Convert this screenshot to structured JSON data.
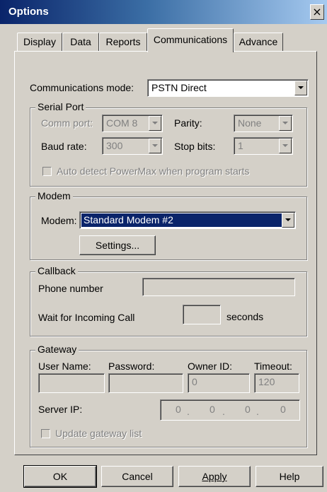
{
  "window": {
    "title": "Options",
    "close_glyph": "×"
  },
  "tabs": [
    {
      "label": "Display",
      "active": false
    },
    {
      "label": "Data",
      "active": false
    },
    {
      "label": "Reports",
      "active": false
    },
    {
      "label": "Communications",
      "active": true
    },
    {
      "label": "Advance",
      "active": false
    }
  ],
  "communications_mode": {
    "label": "Communications mode:",
    "value": "PSTN Direct"
  },
  "serial_port": {
    "legend": "Serial Port",
    "comm_port_label": "Comm port:",
    "comm_port_value": "COM 8",
    "parity_label": "Parity:",
    "parity_value": "None",
    "baud_rate_label": "Baud rate:",
    "baud_rate_value": "300",
    "stop_bits_label": "Stop bits:",
    "stop_bits_value": "1",
    "auto_detect_label": "Auto detect PowerMax when program starts"
  },
  "modem": {
    "legend": "Modem",
    "modem_label": "Modem:",
    "modem_value": "Standard Modem #2",
    "settings_button": "Settings..."
  },
  "callback": {
    "legend": "Callback",
    "phone_label": "Phone number",
    "phone_value": "",
    "wait_label": "Wait for Incoming Call",
    "wait_value": "",
    "seconds_label": "seconds"
  },
  "gateway": {
    "legend": "Gateway",
    "user_name_label": "User Name:",
    "user_name_value": "",
    "password_label": "Password:",
    "password_value": "",
    "owner_id_label": "Owner ID:",
    "owner_id_value": "0",
    "timeout_label": "Timeout:",
    "timeout_value": "120",
    "server_ip_label": "Server IP:",
    "server_ip": [
      "0",
      "0",
      "0",
      "0"
    ],
    "update_label": "Update gateway list"
  },
  "buttons": {
    "ok": "OK",
    "cancel": "Cancel",
    "apply": "Apply",
    "help": "Help"
  }
}
